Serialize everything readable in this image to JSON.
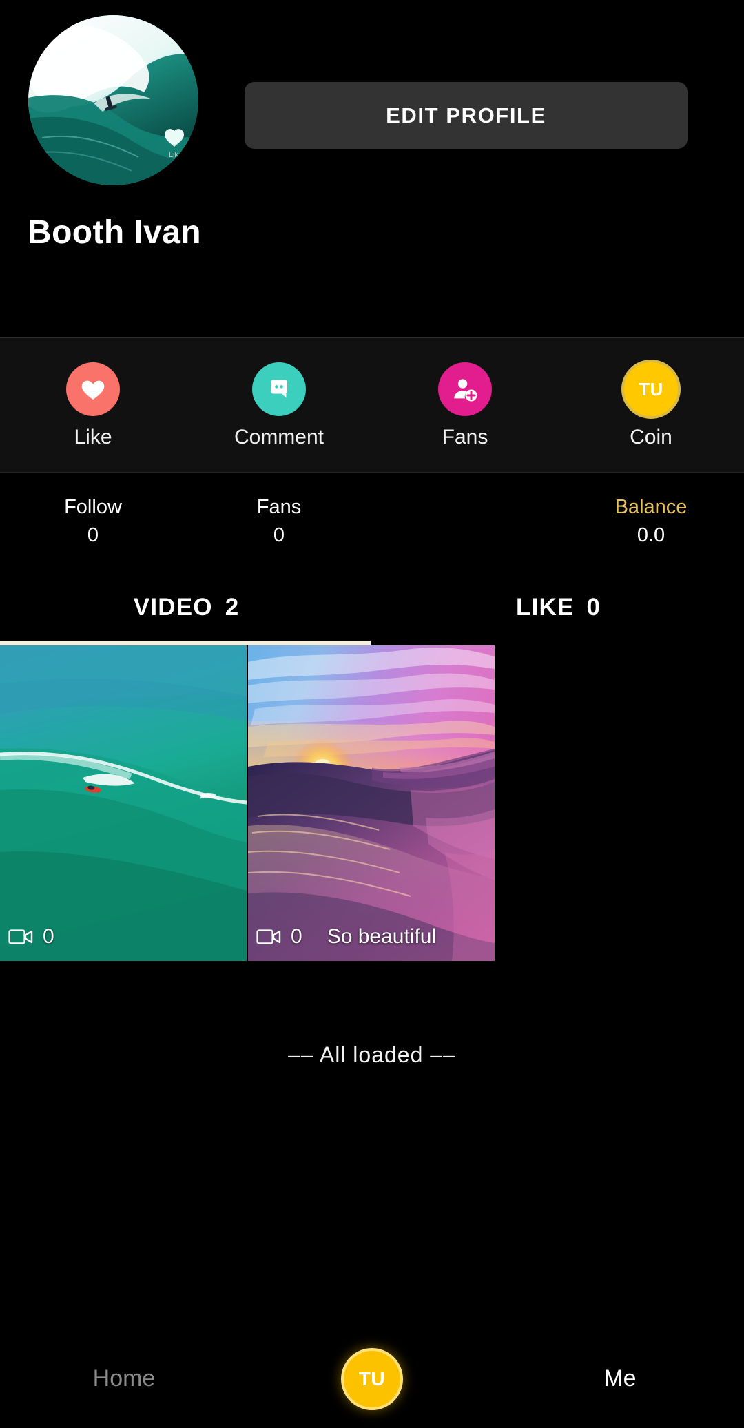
{
  "profile": {
    "display_name": "Booth Ivan",
    "avatar_alt": "surfing-wave-avatar",
    "edit_button_label": "EDIT PROFILE"
  },
  "actions": [
    {
      "label": "Like",
      "icon": "heart-icon",
      "color": "#f9736a"
    },
    {
      "label": "Comment",
      "icon": "chat-icon",
      "color": "#3ccfbe"
    },
    {
      "label": "Fans",
      "icon": "user-plus-icon",
      "color": "#e21d8d"
    },
    {
      "label": "Coin",
      "icon": "coin-icon",
      "color": "#ffc800",
      "badge_text": "TU"
    }
  ],
  "stats": [
    {
      "label": "Follow",
      "value": "0",
      "gold": false
    },
    {
      "label": "Fans",
      "value": "0",
      "gold": false
    },
    {
      "label": "",
      "value": "",
      "gold": false
    },
    {
      "label": "Balance",
      "value": "0.0",
      "gold": true
    }
  ],
  "tabs": [
    {
      "label": "VIDEO",
      "count": "2",
      "active": true
    },
    {
      "label": "LIKE",
      "count": "0",
      "active": false
    }
  ],
  "videos": [
    {
      "views": "0",
      "caption": "",
      "thumb": "turquoise-ocean-wave-surfer"
    },
    {
      "views": "0",
      "caption": "So beautiful",
      "thumb": "purple-sunset-ocean-wave"
    }
  ],
  "footer": {
    "all_loaded_text": "–– All loaded ––"
  },
  "bottom_nav": {
    "home_label": "Home",
    "center_label": "TU",
    "me_label": "Me"
  },
  "colors": {
    "background": "#000000",
    "panel": "#111111",
    "button": "#333333",
    "gold": "#e8c35c",
    "coin": "#ffc800",
    "tab_indicator": "#f3f0e0"
  }
}
